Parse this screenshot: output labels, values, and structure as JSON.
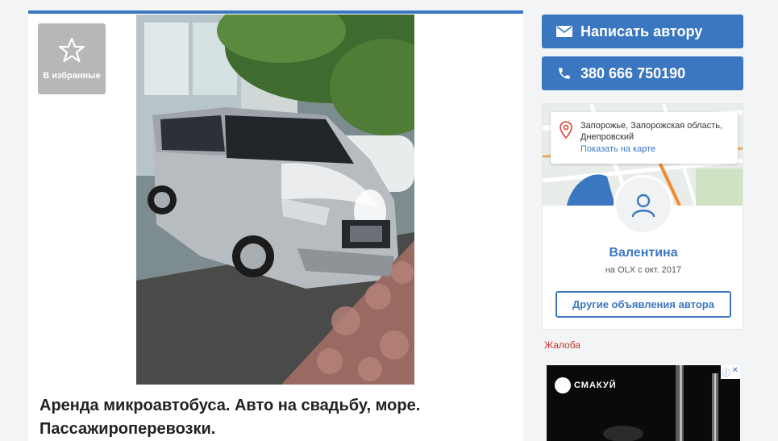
{
  "listing": {
    "favorite_label": "В избранные",
    "title": "Аренда микроавтобуса. Авто на свадьбу, море. Пассажироперевозки."
  },
  "contact": {
    "write_label": "Написать автору",
    "phone": "380 666 750190"
  },
  "location": {
    "address": "Запорожье, Запорожская область, Днепровский",
    "show_map": "Показать на карте"
  },
  "seller": {
    "name": "Валентина",
    "since": "на OLX с окт. 2017",
    "other_ads": "Другие объявления автора"
  },
  "complaint_label": "Жалоба",
  "advert": {
    "brand": "СМАКУЙ",
    "info_icon": "ⓘ",
    "close_icon": "✕"
  },
  "colors": {
    "accent": "#3a77c0",
    "complaint": "#c0392b"
  }
}
